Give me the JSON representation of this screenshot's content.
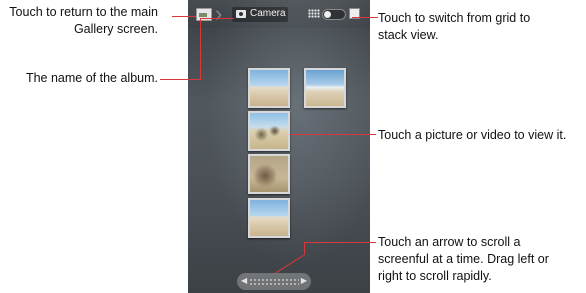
{
  "screen": {
    "album_chip_label": "Camera"
  },
  "callouts": {
    "return_gallery": "Touch to return to the main\nGallery screen.",
    "album_name": "The name of the album.",
    "switch_view": "Touch to switch from grid to\nstack view.",
    "view_item": "Touch a picture or video to view it.",
    "scroll": "Touch an arrow to scroll a\nscreenful at a time. Drag left or\nright to scroll rapidly."
  },
  "icons": {
    "home": "gallery-home-icon",
    "camera": "camera-icon",
    "grid": "grid-view-icon",
    "switch": "view-switch-toggle",
    "stack": "stack-view-icon",
    "left": "left-arrow-icon",
    "right": "right-arrow-icon"
  },
  "colors": {
    "callout_line": "#d8383a"
  }
}
